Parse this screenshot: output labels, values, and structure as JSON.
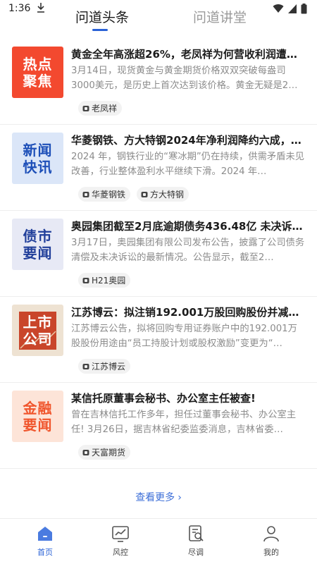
{
  "status_bar": {
    "time": "1:36"
  },
  "tabs": [
    {
      "label": "问道头条",
      "active": true
    },
    {
      "label": "问道讲堂",
      "active": false
    }
  ],
  "news": [
    {
      "thumb_lines": [
        "热点",
        "聚焦"
      ],
      "title": "黄金全年高涨超26%，老凤祥为何营收利润遭…",
      "summary": "3月14日，现货黄金与黄金期货价格双双突破每盎司3000美元，是历史上首次达到该价格。黄金无疑是2…",
      "tags": [
        "老凤祥"
      ]
    },
    {
      "thumb_lines": [
        "新闻",
        "快讯"
      ],
      "title": "华菱钢铁、方大特钢2024年净利润降约六成，…",
      "summary": "2024 年，钢铁行业的“寒冰期”仍在持续，供需矛盾未见改善，行业整体盈利水平继续下滑。2024 年…",
      "tags": [
        "华菱钢铁",
        "方大特钢"
      ]
    },
    {
      "thumb_lines": [
        "债市",
        "要闻"
      ],
      "title": "奥园集团截至2月底逾期债务436.48亿 未决诉…",
      "summary": "3月17日，奥园集团有限公司发布公告，披露了公司债务清偿及未决诉讼的最新情况。公告显示，截至2…",
      "tags": [
        "H21奥园"
      ]
    },
    {
      "thumb_lines": [
        "上市",
        "公司"
      ],
      "title": "江苏博云：拟注销192.001万股回购股份并减…",
      "summary": "江苏博云公告，拟将回购专用证券账户中的192.001万股股份用途由“员工持股计划或股权激励”变更为“…",
      "tags": [
        "江苏博云"
      ]
    },
    {
      "thumb_lines": [
        "金融",
        "要闻"
      ],
      "title": "某信托原董事会秘书、办公室主任被查!",
      "summary": "曾在吉林信托工作多年，担任过董事会秘书、办公室主任! 3月26日，据吉林省纪委监委消息，吉林省委…",
      "tags": [
        "天富期货"
      ]
    }
  ],
  "see_more": "查看更多",
  "bottom_nav": [
    {
      "label": "首页",
      "icon": "home-icon",
      "active": true
    },
    {
      "label": "风控",
      "icon": "risk-chart-icon",
      "active": false
    },
    {
      "label": "尽调",
      "icon": "due-diligence-icon",
      "active": false
    },
    {
      "label": "我的",
      "icon": "profile-icon",
      "active": false
    }
  ],
  "colors": {
    "accent": "#2a62d6",
    "link": "#3d6fd8"
  }
}
